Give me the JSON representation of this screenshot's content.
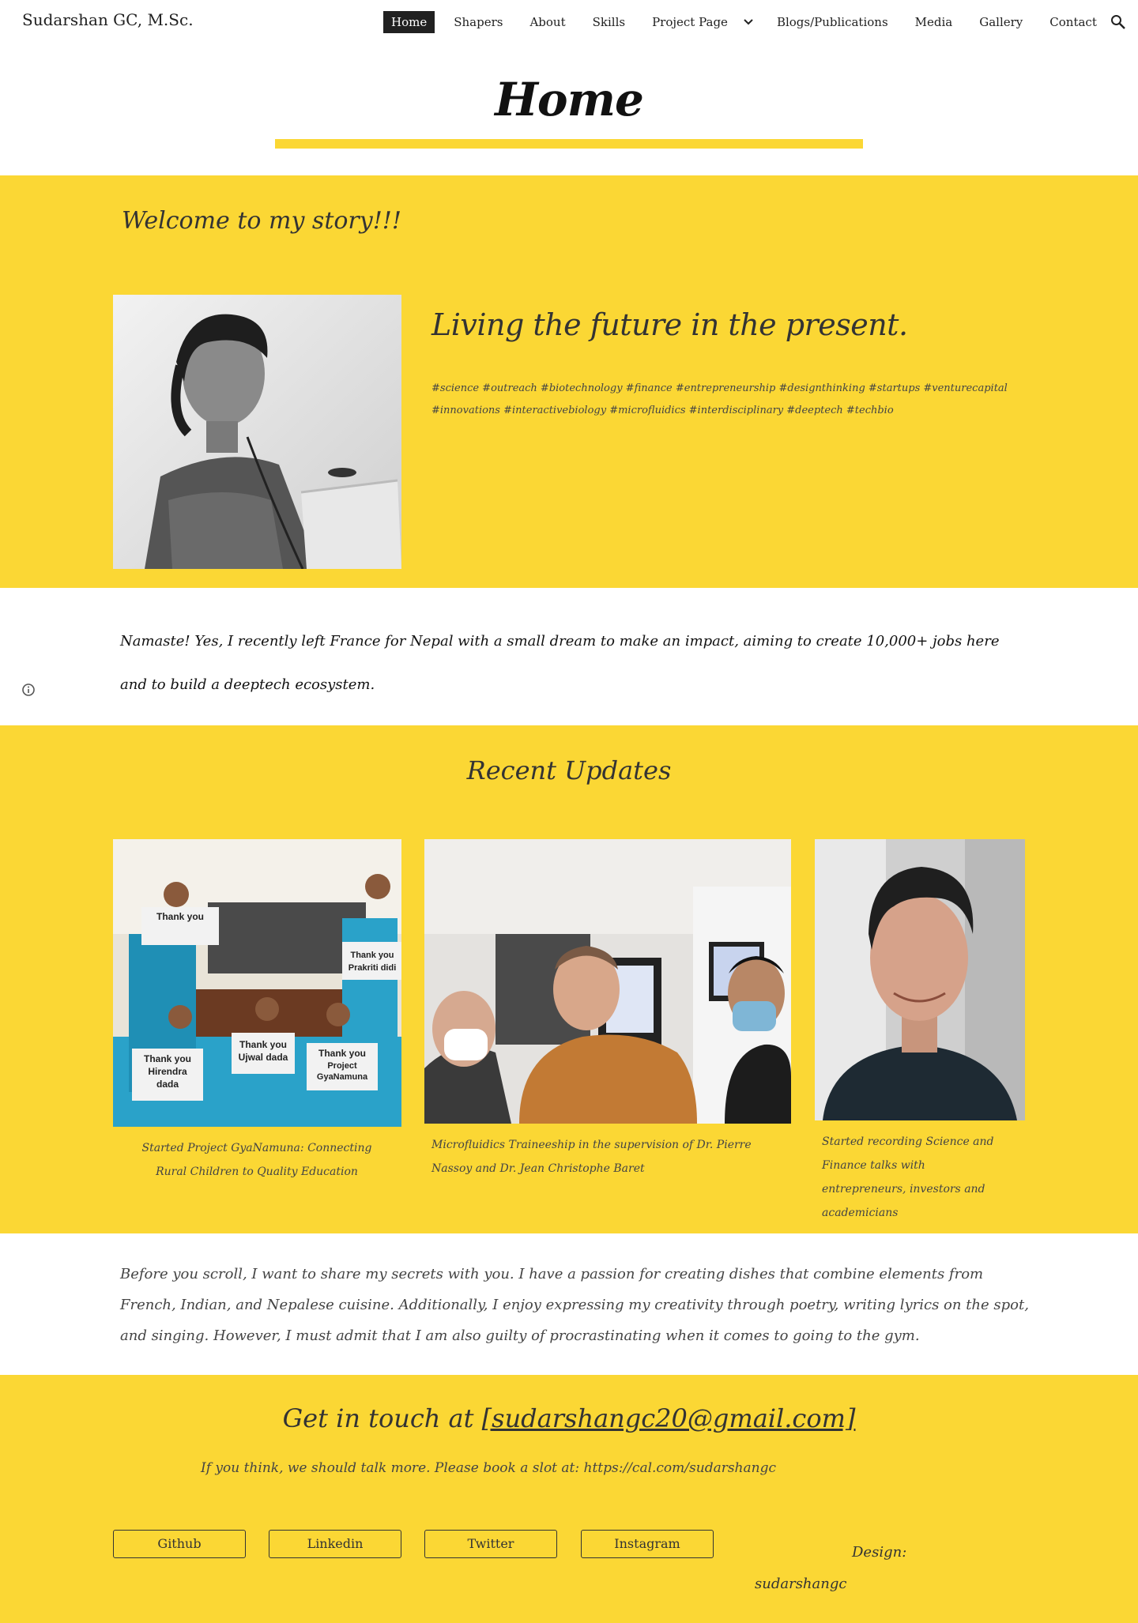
{
  "header": {
    "site_title": "Sudarshan GC, M.Sc.",
    "nav": [
      "Home",
      "Shapers",
      "About",
      "Skills",
      "Project Page",
      "Blogs/Publications",
      "Media",
      "Gallery",
      "Contact"
    ],
    "active_nav": "Home",
    "icons": {
      "dropdown": "chevron-down-icon",
      "search": "search-icon"
    }
  },
  "page": {
    "title": "Home"
  },
  "welcome": {
    "heading": "Welcome to my story!!!",
    "tagline": "Living the future in the present.",
    "hashtags": "#science #outreach #biotechnology #finance #entrepreneurship #designthinking #startups #venturecapital #innovations #interactivebiology #microfluidics #interdisciplinary #deeptech #techbio"
  },
  "intro": {
    "text": "Namaste! Yes, I recently left France for Nepal with a small dream to make an impact, aiming to create 10,000+ jobs here and to build a deeptech ecosystem."
  },
  "updates": {
    "title": "Recent Updates",
    "cards": [
      {
        "caption": "Started Project GyaNamuna: Connecting Rural Children to Quality Education",
        "image_signs": [
          "Thank you",
          "Thank you Prakriti didi",
          "Thank you Hirendra dada",
          "Thank you Ujwal dada",
          "Thank you Project GyaNamuna"
        ]
      },
      {
        "caption": "Microfluidics Traineeship in the supervision of Dr. Pierre Nassoy and Dr. Jean Christophe Baret"
      },
      {
        "caption": "Started recording Science and Finance talks with entrepreneurs, investors and academicians"
      }
    ]
  },
  "secrets": {
    "text": "Before you scroll, I want to share my secrets with you. I have a passion for creating dishes that combine elements from French, Indian, and Nepalese cuisine. Additionally, I enjoy expressing my creativity through poetry, writing lyrics on the spot, and singing. However, I must admit that I am also guilty of procrastinating when it comes to going to the gym."
  },
  "contact": {
    "prefix": "Get in touch at ",
    "email": "[sudarshangc20@gmail.com]",
    "booking": "If you think, we should talk more. Please book a slot at:  https://cal.com/sudarshangc",
    "buttons": [
      "Github",
      "Linkedin",
      "Twitter",
      "Instagram"
    ],
    "design_label": "Design:",
    "design_value": "sudarshangc"
  },
  "colors": {
    "accent": "#fbd734",
    "text": "#212121",
    "nav_active_bg": "#212121"
  }
}
